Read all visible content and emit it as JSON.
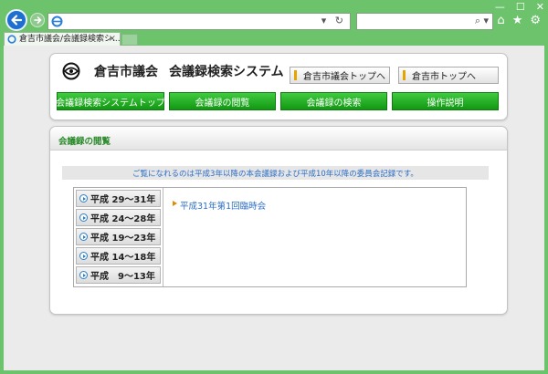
{
  "browser": {
    "tab_title": "倉吉市議会/会議録検索シ...",
    "tab_close": "×",
    "address_controls": "▾ ↻",
    "search_controls": "⌕ ▾",
    "toolbar_home": "⌂",
    "toolbar_favorites": "★",
    "toolbar_settings": "⚙",
    "win_min": "—",
    "win_max": "☐",
    "win_close": "✕",
    "accent_color": "#6cc36c"
  },
  "header": {
    "title_org": "倉吉市議会",
    "title_system": "会議録検索システム",
    "top_links": [
      "倉吉市議会トップへ",
      "倉吉市トップへ"
    ],
    "nav": [
      "会議録検索システムトップ",
      "会議録の閲覧",
      "会議録の検索",
      "操作説明"
    ]
  },
  "main": {
    "section_title": "会議録の閲覧",
    "notice": "ご覧になれるのは平成3年以降の本会議録および平成10年以降の委員会記録です。",
    "year_ranges": [
      "平成 29～31年",
      "平成 24～28年",
      "平成 19～23年",
      "平成 14～18年",
      "平成　9～13年"
    ],
    "sessions": [
      "平成31年第1回臨時会"
    ]
  }
}
